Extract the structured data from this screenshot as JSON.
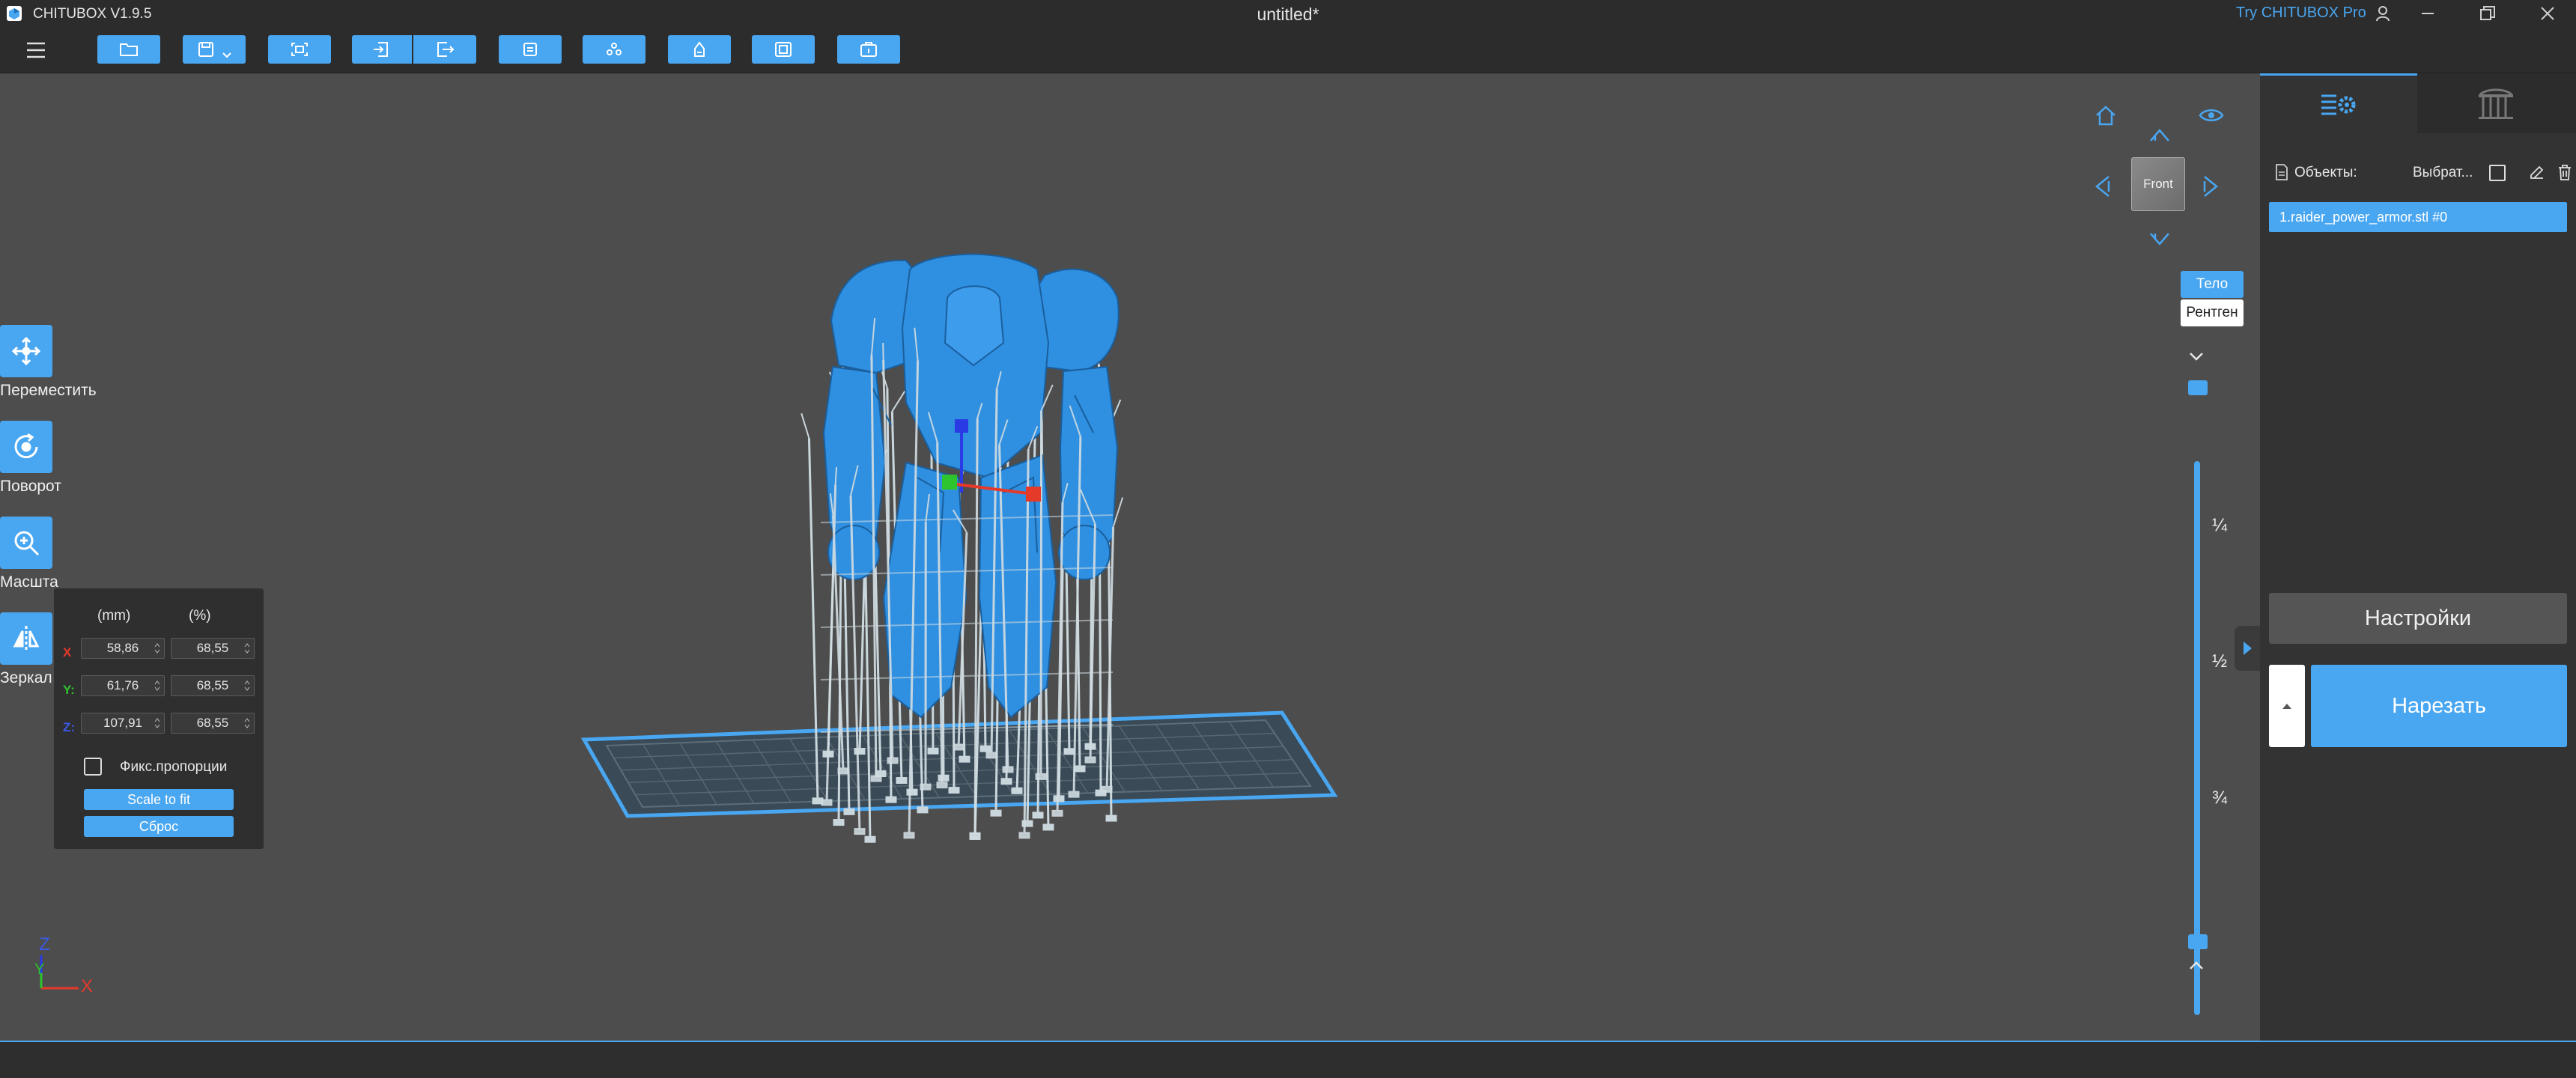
{
  "titlebar": {
    "app_name": "CHITUBOX V1.9.5",
    "document": "untitled*",
    "try_pro": "Try CHITUBOX Pro"
  },
  "toolbar": {
    "buttons": [
      "open-icon",
      "save-icon",
      "fit-icon",
      "import-icon",
      "export-icon",
      "layers-icon",
      "arrange-icon",
      "hollow-icon",
      "print-icon",
      "package-icon"
    ]
  },
  "tools": {
    "move": "Переместить",
    "rotate": "Поворот",
    "scale": "Масшта",
    "mirror": "Зеркал"
  },
  "scale_panel": {
    "head_mm": "(mm)",
    "head_pct": "(%)",
    "axes": {
      "x": "X",
      "y": "Y:",
      "z": "Z:"
    },
    "x_mm": "58,86",
    "x_pct": "68,55",
    "y_mm": "61,76",
    "y_pct": "68,55",
    "z_mm": "107,91",
    "z_pct": "68,55",
    "lock_label": "Фикс.пропорции",
    "scale_to_fit": "Scale to fit",
    "reset": "Сброс"
  },
  "view": {
    "cube_face": "Front",
    "body": "Тело",
    "xray": "Рентген",
    "marks": [
      "¼",
      "½",
      "¾"
    ],
    "axis_labels": {
      "z": "Z",
      "y": "Y",
      "x": "X"
    }
  },
  "right_panel": {
    "objects_label": "Объекты:",
    "select_label": "Выбрат...",
    "objects": [
      "1.raider_power_armor.stl #0"
    ],
    "settings": "Настройки",
    "slice": "Нарезать"
  },
  "colors": {
    "accent": "#49a6f1",
    "model": "#2f8fe0",
    "support": "#c9d6dc",
    "axis_x": "#e53a2a",
    "axis_y": "#2ec42e",
    "axis_z": "#2a3ae5"
  }
}
